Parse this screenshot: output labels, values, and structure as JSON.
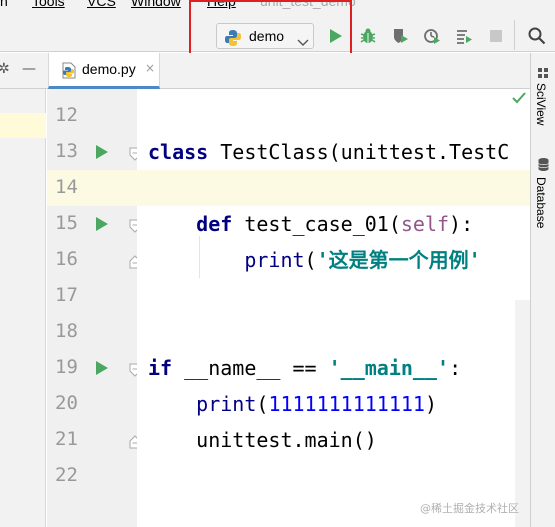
{
  "menubar": {
    "items": [
      "n",
      "Tools",
      "VCS",
      "Window",
      "Help"
    ],
    "title": "unit_test_demo"
  },
  "toolbar": {
    "run_config": "demo",
    "buttons": [
      "run-icon",
      "debug-icon",
      "coverage-icon",
      "profile-icon",
      "run-concurrency-icon",
      "stop-icon",
      "search-icon"
    ],
    "colors": {
      "run": "#4ca860",
      "highlight_box": "#e02020"
    }
  },
  "left_controls": [
    "✲",
    "—"
  ],
  "tab": {
    "label": "demo.py",
    "close": "×"
  },
  "right_tools": [
    "SciView",
    "Database"
  ],
  "editor": {
    "lines": [
      {
        "num": "12",
        "tokens": []
      },
      {
        "num": "13",
        "tokens": [
          [
            "kw",
            "class"
          ],
          [
            "plain",
            " TestClass(unittest.TestC"
          ]
        ]
      },
      {
        "num": "14",
        "tokens": []
      },
      {
        "num": "15",
        "tokens": [
          [
            "plain",
            "    "
          ],
          [
            "kw",
            "def"
          ],
          [
            "plain",
            " test_case_01("
          ],
          [
            "self",
            "self"
          ],
          [
            "plain",
            "):"
          ]
        ]
      },
      {
        "num": "16",
        "tokens": [
          [
            "plain",
            "        "
          ],
          [
            "builtin",
            "print"
          ],
          [
            "plain",
            "("
          ],
          [
            "str",
            "'这是第一个用例'"
          ]
        ]
      },
      {
        "num": "17",
        "tokens": []
      },
      {
        "num": "18",
        "tokens": []
      },
      {
        "num": "19",
        "tokens": [
          [
            "kw",
            "if"
          ],
          [
            "plain",
            " __name__ == "
          ],
          [
            "str",
            "'__main__'"
          ],
          [
            "plain",
            ":"
          ]
        ]
      },
      {
        "num": "20",
        "tokens": [
          [
            "plain",
            "    "
          ],
          [
            "builtin",
            "print"
          ],
          [
            "plain",
            "("
          ],
          [
            "num",
            "1111111111111"
          ],
          [
            "plain",
            ")"
          ]
        ]
      },
      {
        "num": "21",
        "tokens": [
          [
            "plain",
            "    unittest.main()"
          ]
        ]
      },
      {
        "num": "22",
        "tokens": []
      }
    ]
  },
  "watermark": "@稀土掘金技术社区"
}
